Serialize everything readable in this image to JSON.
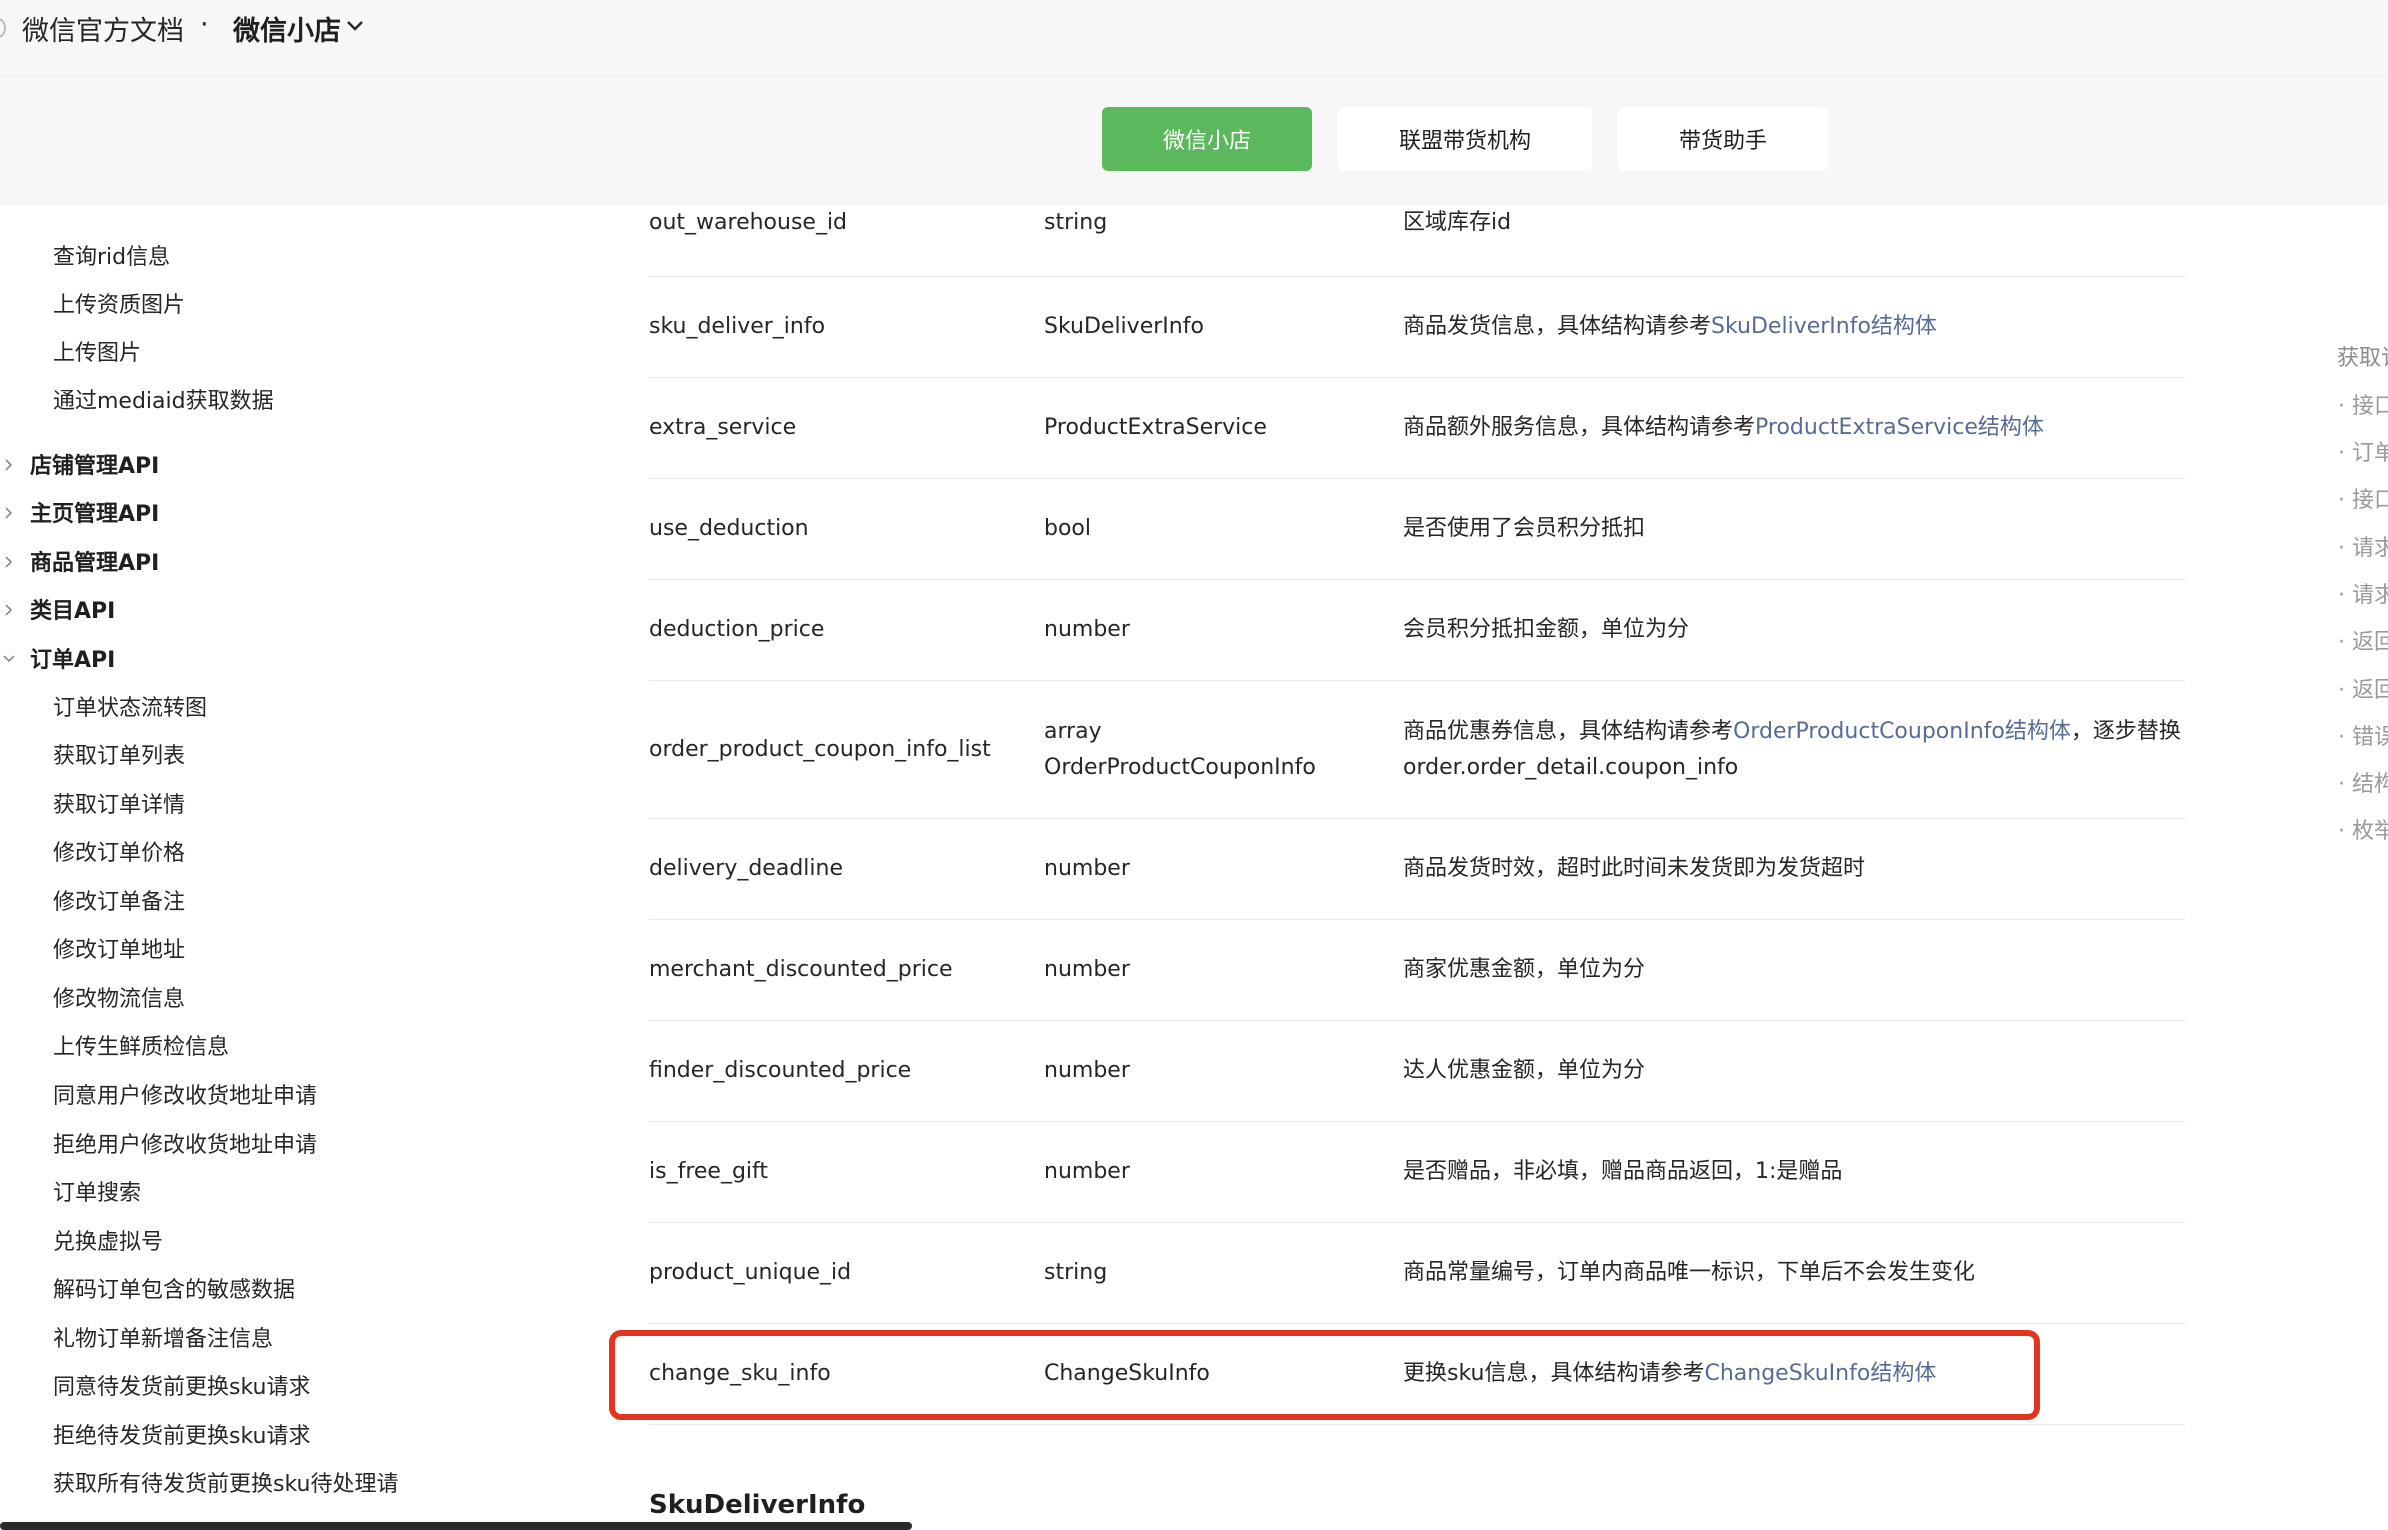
{
  "header": {
    "app_title": "微信官方文档",
    "separator": "·",
    "section_name": "微信小店"
  },
  "tabs": [
    {
      "label": "微信小店",
      "active": true
    },
    {
      "label": "联盟带货机构",
      "active": false
    },
    {
      "label": "带货助手",
      "active": false
    }
  ],
  "sidebar": {
    "leaves_top": [
      "查询rid信息",
      "上传资质图片",
      "上传图片",
      "通过mediaid获取数据"
    ],
    "groups": [
      {
        "label": "店铺管理API",
        "expanded": false
      },
      {
        "label": "主页管理API",
        "expanded": false
      },
      {
        "label": "商品管理API",
        "expanded": false
      },
      {
        "label": "类目API",
        "expanded": false
      },
      {
        "label": "订单API",
        "expanded": true
      }
    ],
    "order_items": [
      "订单状态流转图",
      "获取订单列表",
      "获取订单详情",
      "修改订单价格",
      "修改订单备注",
      "修改订单地址",
      "修改物流信息",
      "上传生鲜质检信息",
      "同意用户修改收货地址申请",
      "拒绝用户修改收货地址申请",
      "订单搜索",
      "兑换虚拟号",
      "解码订单包含的敏感数据",
      "礼物订单新增备注信息",
      "同意待发货前更换sku请求",
      "拒绝待发货前更换sku请求",
      "获取所有待发货前更换sku待处理请"
    ]
  },
  "table": {
    "rows": [
      {
        "field": "out_warehouse_id",
        "type": "string",
        "desc": "区域库存id"
      },
      {
        "field": "sku_deliver_info",
        "type": "SkuDeliverInfo",
        "desc": "商品发货信息，具体结构请参考",
        "link": "SkuDeliverInfo结构体"
      },
      {
        "field": "extra_service",
        "type": "ProductExtraService",
        "desc": "商品额外服务信息，具体结构请参考",
        "link": "ProductExtraService结构体"
      },
      {
        "field": "use_deduction",
        "type": "bool",
        "desc": "是否使用了会员积分抵扣"
      },
      {
        "field": "deduction_price",
        "type": "number",
        "desc": "会员积分抵扣金额，单位为分"
      },
      {
        "field": "order_product_coupon_info_list",
        "type": "array",
        "type2": "OrderProductCouponInfo",
        "desc": "商品优惠券信息，具体结构请参考",
        "link": "OrderProductCouponInfo结构体",
        "desc_tail": "，逐步替换",
        "desc2": "order.order_detail.coupon_info"
      },
      {
        "field": "delivery_deadline",
        "type": "number",
        "desc": "商品发货时效，超时此时间未发货即为发货超时"
      },
      {
        "field": "merchant_discounted_price",
        "type": "number",
        "desc": "商家优惠金额，单位为分"
      },
      {
        "field": "finder_discounted_price",
        "type": "number",
        "desc": "达人优惠金额，单位为分"
      },
      {
        "field": "is_free_gift",
        "type": "number",
        "desc": "是否赠品，非必填，赠品商品返回，1:是赠品"
      },
      {
        "field": "product_unique_id",
        "type": "string",
        "desc": "商品常量编号，订单内商品唯一标识，下单后不会发生变化"
      },
      {
        "field": "change_sku_info",
        "type": "ChangeSkuInfo",
        "desc": "更换sku信息，具体结构请参考",
        "link": "ChangeSkuInfo结构体",
        "highlighted": true
      }
    ]
  },
  "next_section_heading": "SkuDeliverInfo",
  "toc": {
    "title": "获取订",
    "items": [
      "接口",
      "订单",
      "接口",
      "请求",
      "请求",
      "返回",
      "返回",
      "错误",
      "结构",
      "枚举"
    ]
  },
  "colors": {
    "active_tab": "#5cb85c",
    "link": "#576b95",
    "highlight_box": "#e0351e"
  }
}
